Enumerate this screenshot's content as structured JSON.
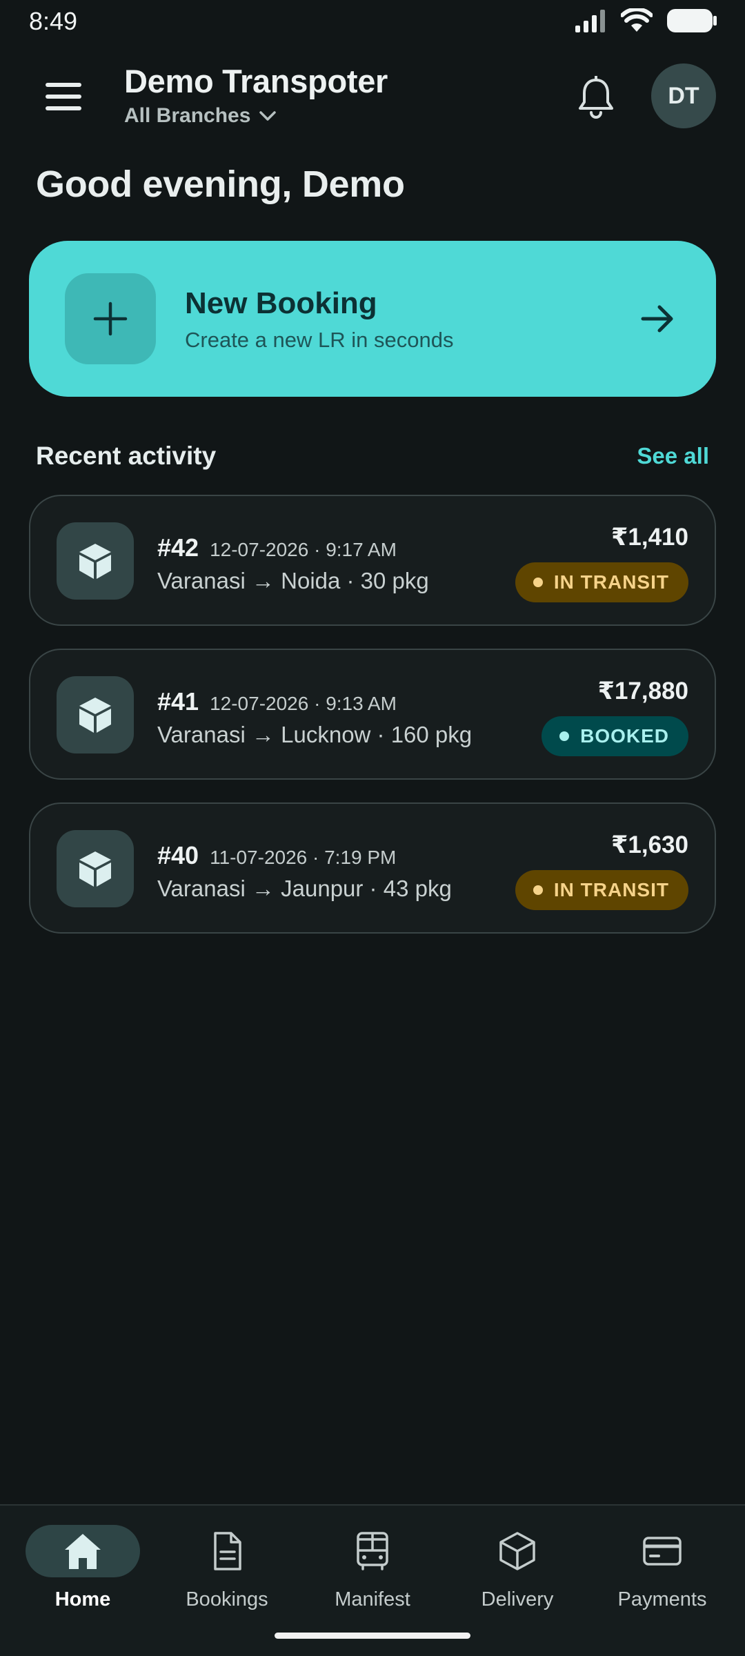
{
  "status_bar": {
    "time": "8:49"
  },
  "header": {
    "company": "Demo Transpoter",
    "branch": "All Branches",
    "avatar_initials": "DT"
  },
  "greeting": "Good evening, Demo",
  "new_booking": {
    "title": "New Booking",
    "subtitle": "Create a new LR in seconds"
  },
  "recent": {
    "title": "Recent activity",
    "see_all": "See all",
    "items": [
      {
        "lr": "#42",
        "datetime": "12-07-2026 · 9:17 AM",
        "route": "Varanasi → Noida · 30 pkg",
        "amount": "₹1,410",
        "status": "IN TRANSIT"
      },
      {
        "lr": "#41",
        "datetime": "12-07-2026 · 9:13 AM",
        "route": "Varanasi → Lucknow · 160 pkg",
        "amount": "₹17,880",
        "status": "BOOKED"
      },
      {
        "lr": "#40",
        "datetime": "11-07-2026 · 7:19 PM",
        "route": "Varanasi → Jaunpur · 43 pkg",
        "amount": "₹1,630",
        "status": "IN TRANSIT"
      }
    ]
  },
  "nav": {
    "items": [
      {
        "label": "Home",
        "icon": "home-icon",
        "active": true
      },
      {
        "label": "Bookings",
        "icon": "document-icon"
      },
      {
        "label": "Manifest",
        "icon": "bus-icon"
      },
      {
        "label": "Delivery",
        "icon": "box-icon"
      },
      {
        "label": "Payments",
        "icon": "card-icon"
      }
    ]
  },
  "colors": {
    "background": "#111617",
    "accent": "#4fd9d6",
    "transit_badge": "#5f4500",
    "booked_badge": "#004a4c"
  }
}
